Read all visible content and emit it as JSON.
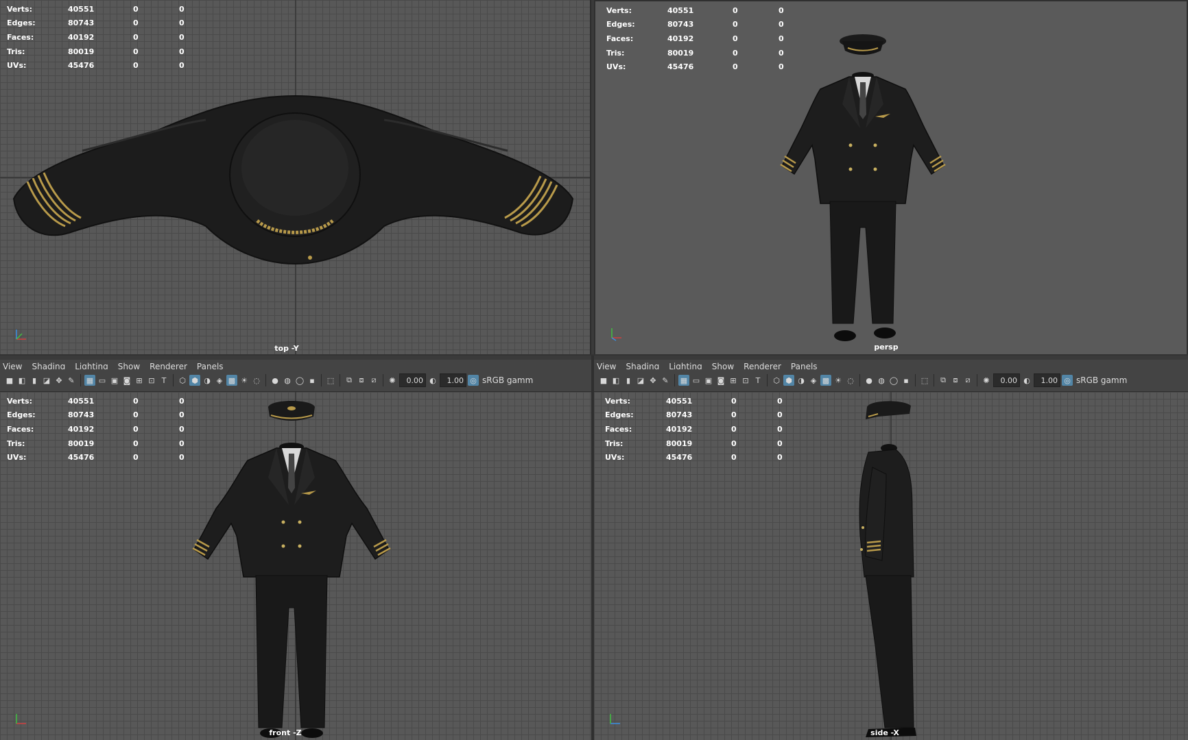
{
  "stats": {
    "rows": [
      {
        "label": "Verts:",
        "v1": "40551",
        "v2": "0",
        "v3": "0"
      },
      {
        "label": "Edges:",
        "v1": "80743",
        "v2": "0",
        "v3": "0"
      },
      {
        "label": "Faces:",
        "v1": "40192",
        "v2": "0",
        "v3": "0"
      },
      {
        "label": "Tris:",
        "v1": "80019",
        "v2": "0",
        "v3": "0"
      },
      {
        "label": "UVs:",
        "v1": "45476",
        "v2": "0",
        "v3": "0"
      }
    ]
  },
  "viewports": {
    "top": {
      "camera": "top -Y"
    },
    "persp": {
      "camera": "persp"
    },
    "front": {
      "camera": "front -Z"
    },
    "side": {
      "camera": "side -X"
    }
  },
  "panel_menu": [
    "View",
    "Shading",
    "Lighting",
    "Show",
    "Renderer",
    "Panels"
  ],
  "toolbar": {
    "exposure": "0.00",
    "gamma": "1.00",
    "colorspace": "sRGB gamm"
  },
  "colors": {
    "viewport_bg": "#585858",
    "grid_line": "#4a4a4a",
    "panel_bg": "#444444",
    "active_icon": "#5285a6",
    "uniform_black": "#1b1b1b",
    "gold_trim": "#b89a4a"
  },
  "icons": [
    "camera-icon",
    "grid-icon",
    "shaded-icon",
    "wireframe-icon",
    "light-icon",
    "isolate-icon",
    "exposure-icon",
    "gamma-icon",
    "colorspace-icon"
  ]
}
